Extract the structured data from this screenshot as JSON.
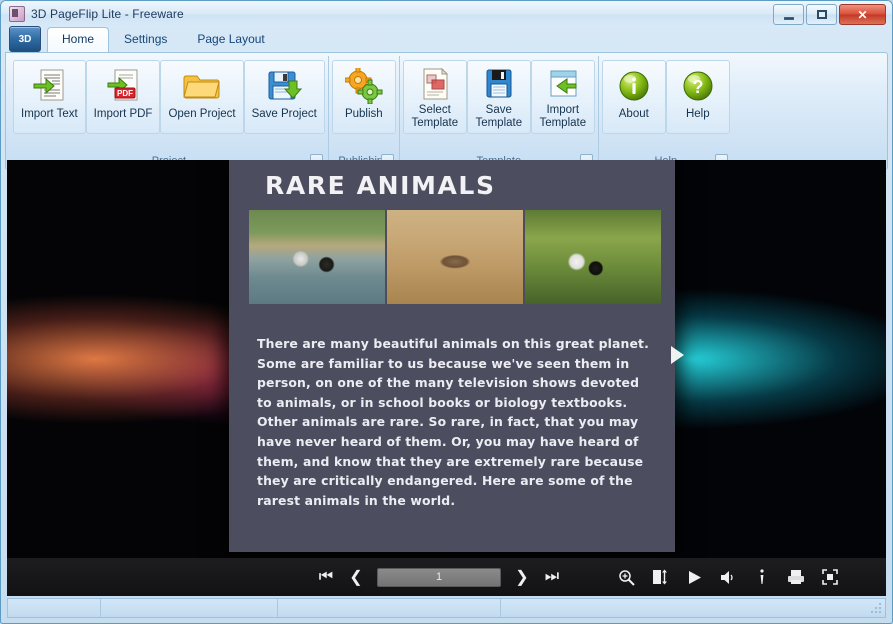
{
  "window": {
    "title": "3D PageFlip Lite - Freeware",
    "app_icon": "app-icon",
    "minimize_label": "",
    "maximize_label": "",
    "close_label": "✕"
  },
  "tabs": {
    "app_button_label": "3D",
    "items": [
      {
        "label": "Home",
        "active": true
      },
      {
        "label": "Settings",
        "active": false
      },
      {
        "label": "Page Layout",
        "active": false
      }
    ]
  },
  "ribbon": {
    "groups": [
      {
        "name": "Project",
        "label": "Project",
        "has_dialog_launcher": true,
        "dialog_launcher_glyph": "⌐",
        "buttons": [
          {
            "label": "Import Text",
            "icon": "import-text-icon"
          },
          {
            "label": "Import PDF",
            "icon": "import-pdf-icon"
          },
          {
            "label": "Open Project",
            "icon": "open-folder-icon"
          },
          {
            "label": "Save Project",
            "icon": "save-disk-icon"
          }
        ]
      },
      {
        "name": "Publishing",
        "label": "Publishing",
        "has_dialog_launcher": true,
        "dialog_launcher_glyph": "⌐",
        "buttons": [
          {
            "label": "Publish",
            "icon": "publish-gears-icon"
          }
        ]
      },
      {
        "name": "Template",
        "label": "Template",
        "has_dialog_launcher": true,
        "dialog_launcher_glyph": "⌐",
        "buttons": [
          {
            "label": "Select\nTemplate",
            "icon": "select-template-icon"
          },
          {
            "label": "Save\nTemplate",
            "icon": "save-template-icon"
          },
          {
            "label": "Import\nTemplate",
            "icon": "import-template-icon"
          }
        ]
      },
      {
        "name": "Help",
        "label": "Help",
        "has_dialog_launcher": true,
        "dialog_launcher_glyph": "⌐",
        "buttons": [
          {
            "label": "About",
            "icon": "about-info-icon"
          },
          {
            "label": "Help",
            "icon": "help-question-icon"
          }
        ]
      }
    ]
  },
  "viewer": {
    "page": {
      "title": "RARE ANIMALS",
      "body": "There are many beautiful animals on this great planet. Some are familiar to us because we've seen them in person, on one of the many television shows devoted to animals, or in school books or biology textbooks.  Other animals are rare.  So rare, in fact, that you may have never heard of them.  Or, you may have heard of them, and know that they are extremely rare because they are critically endangered.  Here are some of the rarest animals in the world.",
      "photos": [
        {
          "alt": "birds-wading-in-water-photo"
        },
        {
          "alt": "antelope-in-grassland-photo"
        },
        {
          "alt": "panda-in-foliage-photo"
        }
      ]
    },
    "background": {
      "left_accent": "#e97e46",
      "left_accent_2": "#cd2378",
      "right_accent": "#28dce6"
    },
    "flip_next_arrow": "next-page-arrow"
  },
  "toolbar": {
    "first_label": "⏮",
    "prev_label": "❮",
    "page_value": "1",
    "page_placeholder": "1",
    "next_label": "❯",
    "last_label": "⏭",
    "tools": [
      {
        "name": "zoom-in-icon",
        "label": "zoom-in"
      },
      {
        "name": "page-mode-icon",
        "label": "single-double-page"
      },
      {
        "name": "play-icon",
        "label": "auto-flip"
      },
      {
        "name": "sound-icon",
        "label": "sound"
      },
      {
        "name": "info-icon",
        "label": "about"
      },
      {
        "name": "print-icon",
        "label": "print"
      },
      {
        "name": "fullscreen-icon",
        "label": "fullscreen"
      }
    ]
  },
  "status": {
    "cell1": "",
    "cell2": "",
    "cell3": "",
    "cell4": ""
  }
}
